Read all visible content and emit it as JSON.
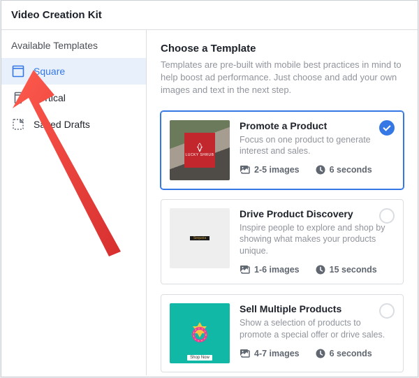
{
  "header": {
    "title": "Video Creation Kit"
  },
  "sidebar": {
    "heading": "Available Templates",
    "items": [
      {
        "label": "Square"
      },
      {
        "label": "Vertical"
      },
      {
        "label": "Saved Drafts"
      }
    ]
  },
  "main": {
    "title": "Choose a Template",
    "desc": "Templates are pre-built with mobile best practices in mind to help boost ad performance. Just choose and add your own images and text in the next step."
  },
  "cards": [
    {
      "title": "Promote a Product",
      "desc": "Focus on one product to generate interest and sales.",
      "images": "2-5 images",
      "duration": "6 seconds",
      "selected": true
    },
    {
      "title": "Drive Product Discovery",
      "desc": "Inspire people to explore and shop by showing what makes your products unique.",
      "images": "1-6 images",
      "duration": "15 seconds",
      "selected": false
    },
    {
      "title": "Sell Multiple Products",
      "desc": "Show a selection of products to promote a special offer or drive sales.",
      "images": "4-7 images",
      "duration": "6 seconds",
      "selected": false
    }
  ],
  "thumb_text": {
    "badge1": "LUCKY SHRUB",
    "grid_center": "Sequoia",
    "shop_now": "Shop Now"
  }
}
